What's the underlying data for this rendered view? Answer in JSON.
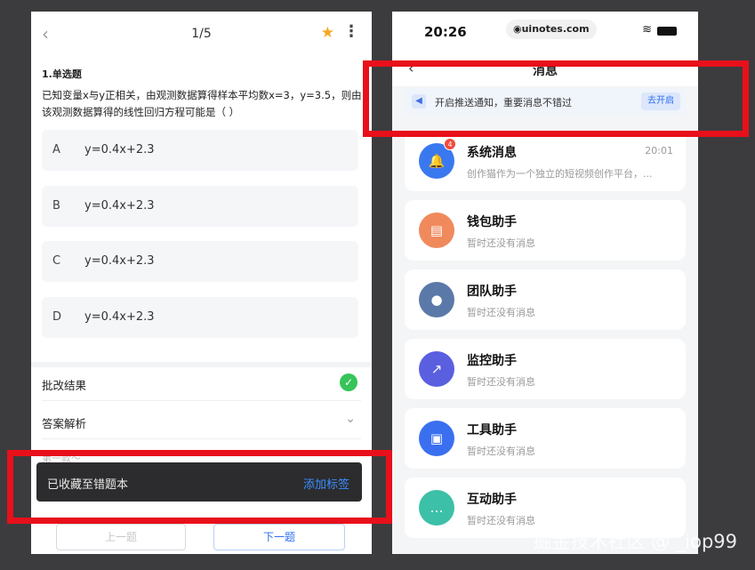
{
  "left": {
    "counter": "1/5",
    "back_icon": "‹",
    "star_icon": "★",
    "more_icon": "⋮",
    "question_type": "1.单选题",
    "question_text": "已知变量x与y正相关，由观测数据算得样本平均数x=3，y=3.5，则由该观测数据算得的线性回归方程可能是（    ）",
    "options": [
      {
        "letter": "A",
        "text": "y=0.4x+2.3"
      },
      {
        "letter": "B",
        "text": "y=0.4x+2.3"
      },
      {
        "letter": "C",
        "text": "y=0.4x+2.3"
      },
      {
        "letter": "D",
        "text": "y=0.4x+2.3"
      }
    ],
    "grading_label": "批改结果",
    "analysis_label": "答案解析",
    "faded_text": "第一款～",
    "check_icon": "✓",
    "chevron_icon": "⌄",
    "toast_text": "已收藏至错题本",
    "toast_action": "添加标签",
    "prev_label": "上一题",
    "next_label": "下一题"
  },
  "right": {
    "time": "20:26",
    "url": "◉uinotes.com",
    "wifi_icon": "≋",
    "back_icon": "‹",
    "nav_title": "消息",
    "notify_text": "开启推送通知，重要消息不错过",
    "notify_button": "去开启",
    "speaker_icon": "◀",
    "messages": [
      {
        "title": "系统消息",
        "sub": "创作猫作为一个独立的短视频创作平台，...",
        "time": "20:01",
        "badge": "4",
        "color": "#3a78f0",
        "icon": "🔔"
      },
      {
        "title": "钱包助手",
        "sub": "暂时还没有消息",
        "time": "",
        "badge": "",
        "color": "#f08a5d",
        "icon": "▤"
      },
      {
        "title": "团队助手",
        "sub": "暂时还没有消息",
        "time": "",
        "badge": "",
        "color": "#5b79a8",
        "icon": "●"
      },
      {
        "title": "监控助手",
        "sub": "暂时还没有消息",
        "time": "",
        "badge": "",
        "color": "#5a5fe0",
        "icon": "↗"
      },
      {
        "title": "工具助手",
        "sub": "暂时还没有消息",
        "time": "",
        "badge": "",
        "color": "#3a6ff0",
        "icon": "▣"
      },
      {
        "title": "互动助手",
        "sub": "暂时还没有消息",
        "time": "",
        "badge": "",
        "color": "#3cc0a8",
        "icon": "…"
      }
    ]
  },
  "watermark": "掘金技术社区 @ _iop99"
}
